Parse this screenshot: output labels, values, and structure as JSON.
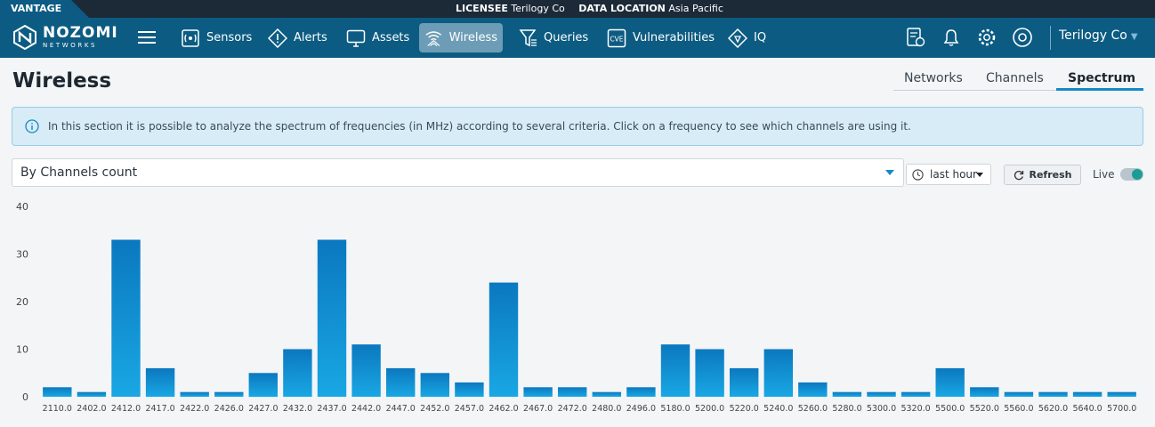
{
  "topbar": {
    "product": "VANTAGE",
    "licensee_label": "LICENSEE",
    "licensee_value": "Terilogy Co",
    "location_label": "DATA LOCATION",
    "location_value": "Asia Pacific"
  },
  "brand": {
    "name": "NOZOMI",
    "sub": "NETWORKS"
  },
  "nav": {
    "items": [
      {
        "label": "Sensors",
        "icon": "sensors-icon"
      },
      {
        "label": "Alerts",
        "icon": "alerts-icon"
      },
      {
        "label": "Assets",
        "icon": "monitor-icon"
      },
      {
        "label": "Wireless",
        "icon": "wireless-icon",
        "active": true
      },
      {
        "label": "Queries",
        "icon": "queries-icon"
      },
      {
        "label": "Vulnerabilities",
        "icon": "cve-icon"
      },
      {
        "label": "IQ",
        "icon": "iq-icon"
      }
    ],
    "user": "Terilogy Co"
  },
  "page": {
    "title": "Wireless",
    "tabs": [
      {
        "label": "Networks"
      },
      {
        "label": "Channels"
      },
      {
        "label": "Spectrum",
        "active": true
      }
    ],
    "info_text": "In this section it is possible to analyze the spectrum of frequencies (in MHz) according to several criteria. Click on a frequency to see which channels are using it."
  },
  "controls": {
    "criteria_selected": "By Channels count",
    "time_range": "last hour",
    "refresh_label": "Refresh",
    "live_label": "Live",
    "live_enabled": true
  },
  "colors": {
    "accent": "#1589c6",
    "nav_bg": "#0c5b82",
    "bar_top": "#0b78bf",
    "bar_bottom": "#19a7e4"
  },
  "chart_data": {
    "type": "bar",
    "categories": [
      "2110.0",
      "2402.0",
      "2412.0",
      "2417.0",
      "2422.0",
      "2426.0",
      "2427.0",
      "2432.0",
      "2437.0",
      "2442.0",
      "2447.0",
      "2452.0",
      "2457.0",
      "2462.0",
      "2467.0",
      "2472.0",
      "2480.0",
      "2496.0",
      "5180.0",
      "5200.0",
      "5220.0",
      "5240.0",
      "5260.0",
      "5280.0",
      "5300.0",
      "5320.0",
      "5500.0",
      "5520.0",
      "5560.0",
      "5620.0",
      "5640.0",
      "5700.0"
    ],
    "values": [
      2,
      1,
      33,
      6,
      1,
      1,
      5,
      10,
      33,
      11,
      6,
      5,
      3,
      24,
      2,
      2,
      1,
      2,
      11,
      10,
      6,
      10,
      3,
      1,
      1,
      1,
      6,
      2,
      1,
      1,
      1,
      1
    ],
    "ylim": [
      0,
      40
    ],
    "yticks": [
      0,
      10,
      20,
      30,
      40
    ],
    "grid": false
  }
}
